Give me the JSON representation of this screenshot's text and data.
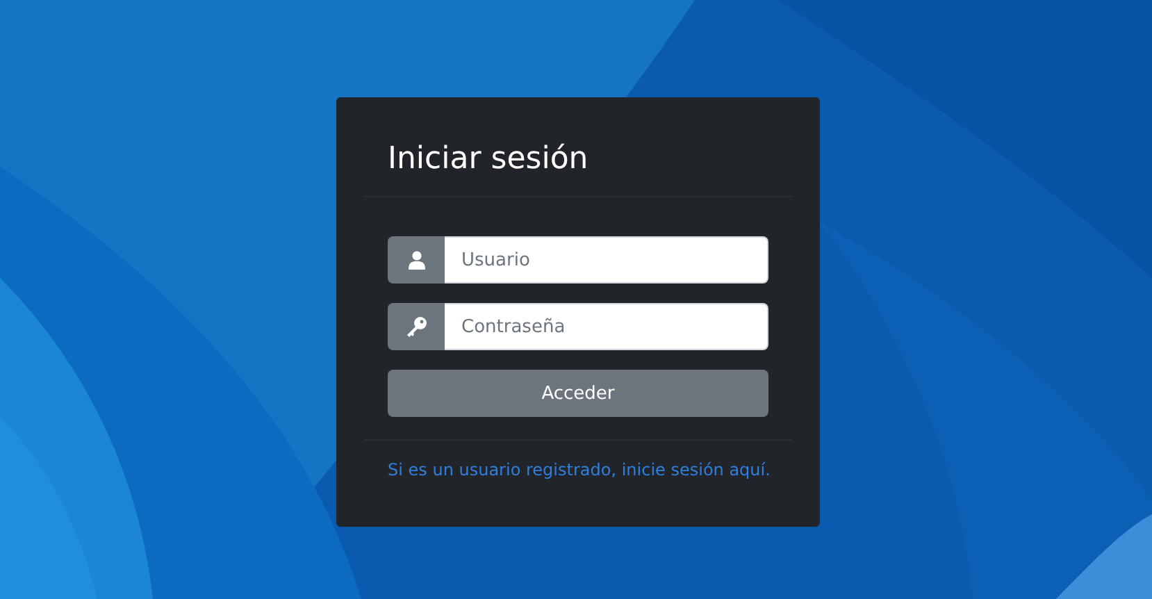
{
  "login_card": {
    "title": "Iniciar sesión",
    "fields": [
      {
        "kind": "user",
        "placeholder": "Usuario"
      },
      {
        "kind": "password",
        "placeholder": "Contraseña"
      }
    ],
    "submit_button": "Acceder",
    "footer_link": "Si es un usuario registrado, inicie sesión aquí."
  }
}
